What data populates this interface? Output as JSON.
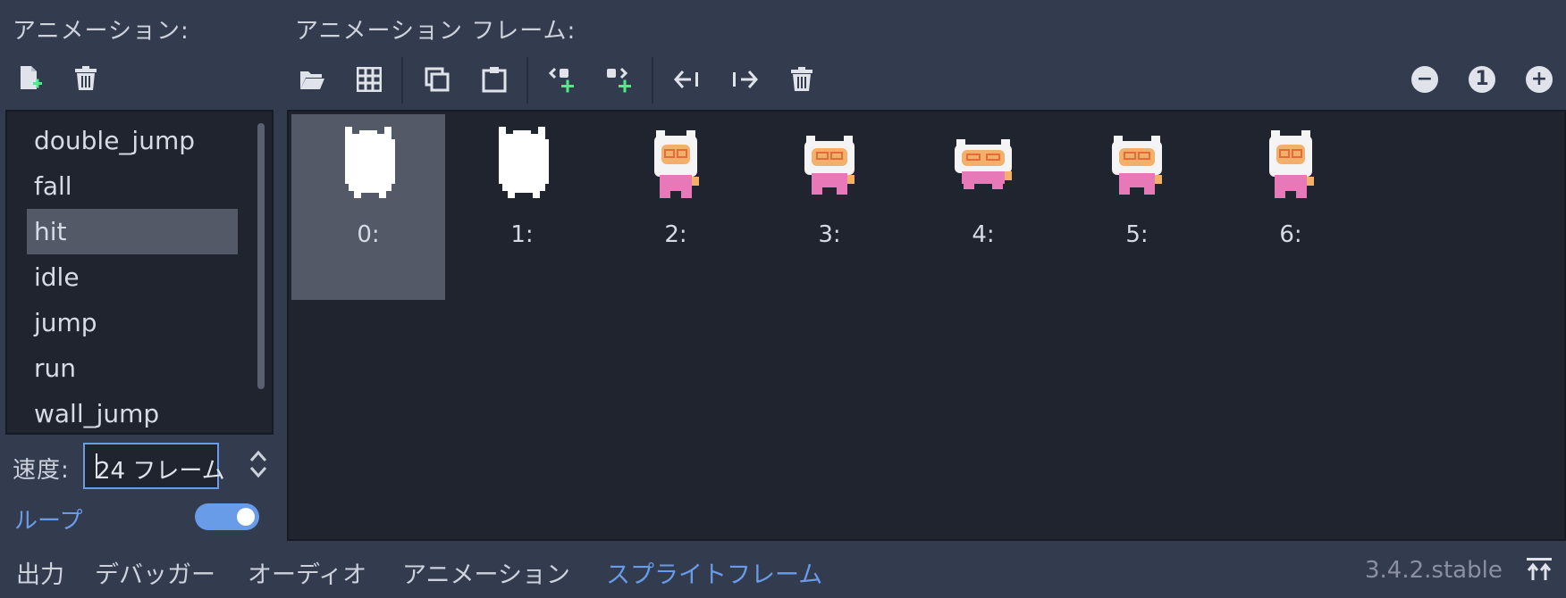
{
  "left_panel": {
    "title": "アニメーション:",
    "new_icon": "new-file-icon",
    "delete_icon": "trash-icon",
    "animations": [
      "double_jump",
      "fall",
      "hit",
      "idle",
      "jump",
      "run",
      "wall_jump"
    ],
    "selected_animation": "hit",
    "speed_label": "速度:",
    "speed_value": "24 フレーム",
    "loop_label": "ループ",
    "loop_on": true
  },
  "frames_panel": {
    "title": "アニメーション フレーム:",
    "toolbar_icons": [
      "folder-open-icon",
      "grid-icon",
      "copy-icon",
      "paste-icon",
      "insert-before-icon",
      "insert-after-icon",
      "move-left-icon",
      "move-right-icon",
      "trash-icon"
    ],
    "zoom_out": "−",
    "zoom_reset": "1",
    "zoom_in": "+",
    "frames": [
      {
        "label": "0:",
        "kind": "silhouette"
      },
      {
        "label": "1:",
        "kind": "silhouette"
      },
      {
        "label": "2:",
        "kind": "character"
      },
      {
        "label": "3:",
        "kind": "character"
      },
      {
        "label": "4:",
        "kind": "character"
      },
      {
        "label": "5:",
        "kind": "character"
      },
      {
        "label": "6:",
        "kind": "character"
      }
    ],
    "selected_frame": 0
  },
  "bottom_bar": {
    "tabs": [
      "出力",
      "デバッガー",
      "オーディオ",
      "アニメーション",
      "スプライトフレーム"
    ],
    "active_tab": "スプライトフレーム",
    "version": "3.4.2.stable"
  },
  "colors": {
    "background": "#333b4f",
    "panel": "#20242f",
    "selection": "#535967",
    "accent": "#699ce8",
    "plus_green": "#56e68c",
    "character_pink": "#e879b8",
    "character_visor": "#f2b06a"
  }
}
